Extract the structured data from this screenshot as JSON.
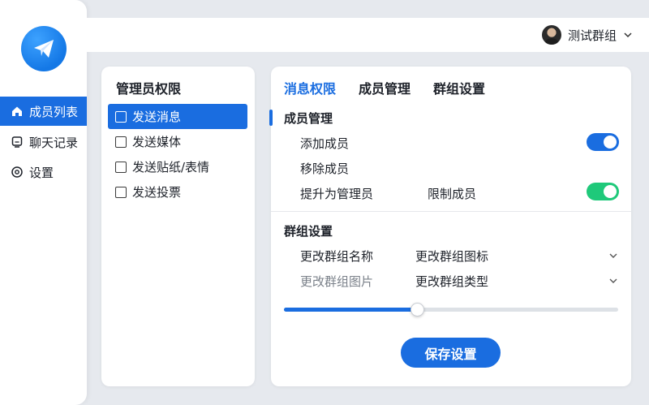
{
  "sidebar": {
    "items": [
      {
        "label": "成员列表",
        "icon": "home-icon",
        "active": true
      },
      {
        "label": "聊天记录",
        "icon": "chat-icon",
        "active": false
      },
      {
        "label": "设置",
        "icon": "settings-icon",
        "active": false
      }
    ]
  },
  "header": {
    "user_name": "测试群组"
  },
  "permissions": {
    "title": "管理员权限",
    "items": [
      {
        "label": "发送消息",
        "active": true
      },
      {
        "label": "发送媒体",
        "active": false
      },
      {
        "label": "发送贴纸/表情",
        "active": false
      },
      {
        "label": "发送投票",
        "active": false
      }
    ]
  },
  "settings": {
    "tabs": [
      {
        "label": "消息权限",
        "active": true
      },
      {
        "label": "成员管理",
        "active": false
      },
      {
        "label": "群组设置",
        "active": false
      }
    ],
    "member_section": {
      "title": "成员管理",
      "add_member": "添加成员",
      "add_member_on": true,
      "remove_member": "移除成员",
      "promote_admin": "提升为管理员",
      "restrict_member": "限制成员",
      "restrict_member_on": true
    },
    "group_section": {
      "title": "群组设置",
      "change_name": "更改群组名称",
      "change_icon": "更改群组图标",
      "change_image": "更改群组图片",
      "change_type": "更改群组类型"
    },
    "slider_value": 0.398,
    "save_label": "保存设置"
  },
  "colors": {
    "accent": "#1a6de0",
    "toggle_green": "#1fc97a",
    "background": "#e6e9ee"
  }
}
